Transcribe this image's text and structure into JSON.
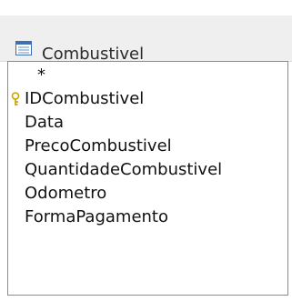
{
  "table": {
    "title": "Combustivel",
    "title_icon": "table-icon",
    "fields": [
      {
        "label": "*",
        "primary_key": false
      },
      {
        "label": "IDCombustivel",
        "primary_key": true,
        "icon": "key-icon"
      },
      {
        "label": "Data",
        "primary_key": false
      },
      {
        "label": "PrecoCombustivel",
        "primary_key": false
      },
      {
        "label": "QuantidadeCombustivel",
        "primary_key": false
      },
      {
        "label": "Odometro",
        "primary_key": false
      },
      {
        "label": "FormaPagamento",
        "primary_key": false
      }
    ]
  },
  "colors": {
    "title_bar": "#efefef",
    "border": "#8c8c8c",
    "key_icon": "#c8a000"
  }
}
